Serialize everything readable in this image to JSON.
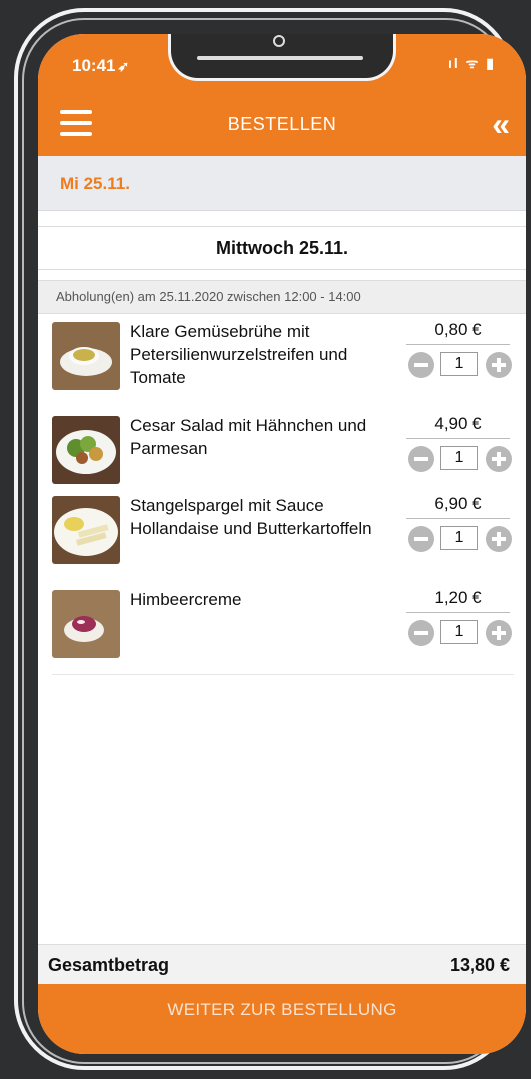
{
  "status": {
    "time": "10:41",
    "location_glyph": "➶",
    "icons": "ıl ᯤ ▮"
  },
  "header": {
    "title": "BESTELLEN",
    "back_glyph": "«"
  },
  "date_bar": {
    "label": "Mi 25.11."
  },
  "day": {
    "title": "Mittwoch 25.11."
  },
  "pickup": {
    "text": "Abholung(en) am 25.11.2020 zwischen 12:00 - 14:00"
  },
  "items": [
    {
      "name": "Klare Gemüsebrühe mit Petersilienwurzelstreifen und Tomate",
      "price": "0,80 €",
      "qty": "1",
      "image": "soup-icon"
    },
    {
      "name": "Cesar Salad mit Hähnchen und Parmesan",
      "price": "4,90 €",
      "qty": "1",
      "image": "salad-icon"
    },
    {
      "name": "Stangelspargel mit Sauce Hollandaise und Butterkartoffeln",
      "price": "6,90 €",
      "qty": "1",
      "image": "asparagus-icon"
    },
    {
      "name": "Himbeercreme",
      "price": "1,20 €",
      "qty": "1",
      "image": "dessert-icon"
    }
  ],
  "total": {
    "label": "Gesamtbetrag",
    "value": "13,80 €"
  },
  "footer": {
    "button_label": "WEITER ZUR BESTELLUNG"
  },
  "colors": {
    "accent": "#ee7d22",
    "background": "#2e2f31"
  }
}
